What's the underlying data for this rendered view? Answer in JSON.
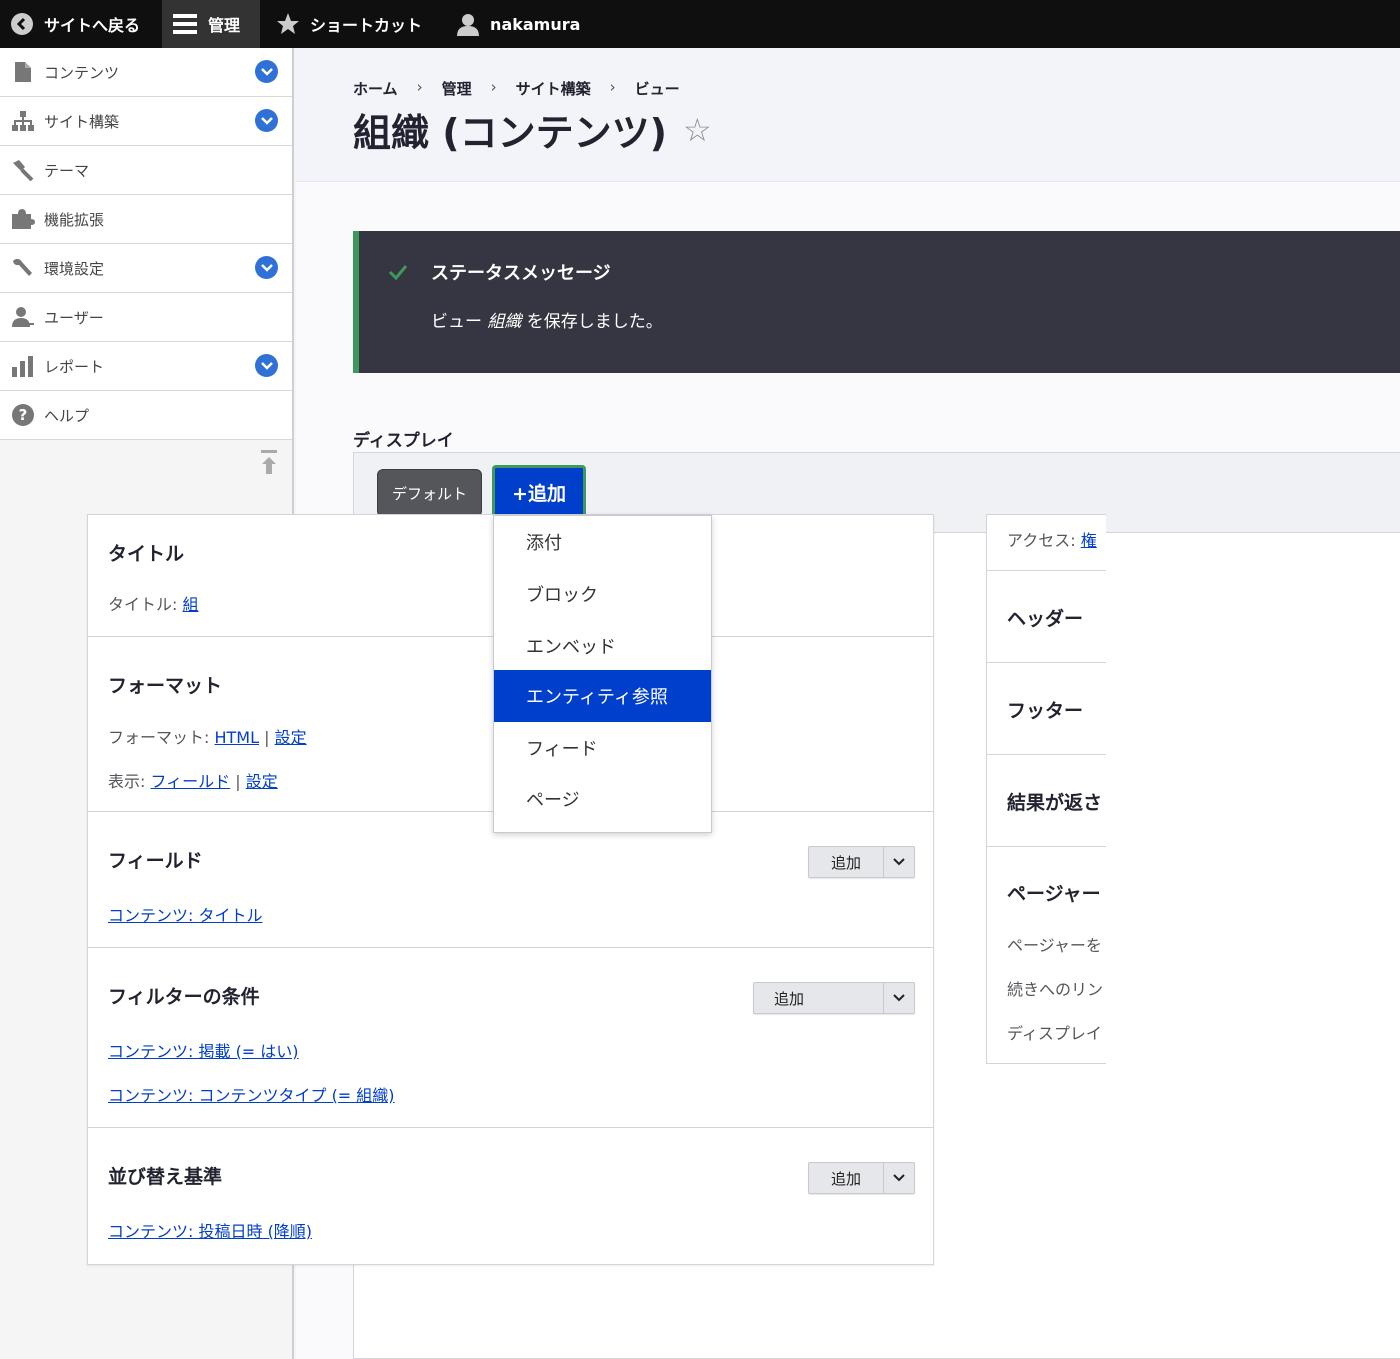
{
  "toolbar": {
    "back_label": "サイトへ戻る",
    "manage_label": "管理",
    "shortcut_label": "ショートカット",
    "user_label": "nakamura"
  },
  "sidebar": {
    "items": [
      {
        "label": "コンテンツ",
        "icon": "file-icon",
        "expandable": true
      },
      {
        "label": "サイト構築",
        "icon": "sitemap-icon",
        "expandable": true
      },
      {
        "label": "テーマ",
        "icon": "paintbrush-icon",
        "expandable": false
      },
      {
        "label": "機能拡張",
        "icon": "puzzle-icon",
        "expandable": false
      },
      {
        "label": "環境設定",
        "icon": "wrench-icon",
        "expandable": true
      },
      {
        "label": "ユーザー",
        "icon": "user-icon",
        "expandable": false
      },
      {
        "label": "レポート",
        "icon": "bar-chart-icon",
        "expandable": true
      },
      {
        "label": "ヘルプ",
        "icon": "help-icon",
        "expandable": false
      }
    ]
  },
  "breadcrumb": [
    "ホーム",
    "管理",
    "サイト構築",
    "ビュー"
  ],
  "page": {
    "title": "組織 (コンテンツ)",
    "star": "☆"
  },
  "status": {
    "title": "ステータスメッセージ",
    "msg_prefix": "ビュー ",
    "msg_name": "組織",
    "msg_suffix": " を保存しました。"
  },
  "displays": {
    "label": "ディスプレイ",
    "default_tab": "デフォルト",
    "add_button": "+追加"
  },
  "dropdown": {
    "items": [
      "添付",
      "ブロック",
      "エンベッド",
      "エンティティ参照",
      "フィード",
      "ページ"
    ],
    "selected_index": 3
  },
  "left_col": {
    "title_section": {
      "heading": "タイトル",
      "label": "タイトル:",
      "value": "組"
    },
    "format_section": {
      "heading": "フォーマット",
      "format_label": "フォーマット:",
      "format_value": "HTML",
      "format_settings": "設定",
      "show_label": "表示:",
      "show_value": "フィールド",
      "show_settings": "設定"
    },
    "fields_section": {
      "heading": "フィールド",
      "add": "追加",
      "items": [
        "コンテンツ: タイトル"
      ]
    },
    "filters_section": {
      "heading": "フィルターの条件",
      "add": "追加",
      "items": [
        "コンテンツ: 掲載 (= はい)",
        "コンテンツ: コンテンツタイプ (= 組織)"
      ]
    },
    "sort_section": {
      "heading": "並び替え基準",
      "add": "追加",
      "items": [
        "コンテンツ: 投稿日時 (降順)"
      ]
    }
  },
  "right_col": {
    "access_label": "アクセス:",
    "access_value": "権",
    "header": "ヘッダー",
    "footer": "フッター",
    "no_results": "結果が返さ",
    "pager": "ページャー",
    "pager_lines": [
      "ページャーを",
      "続きへのリン",
      "ディスプレイ"
    ]
  }
}
